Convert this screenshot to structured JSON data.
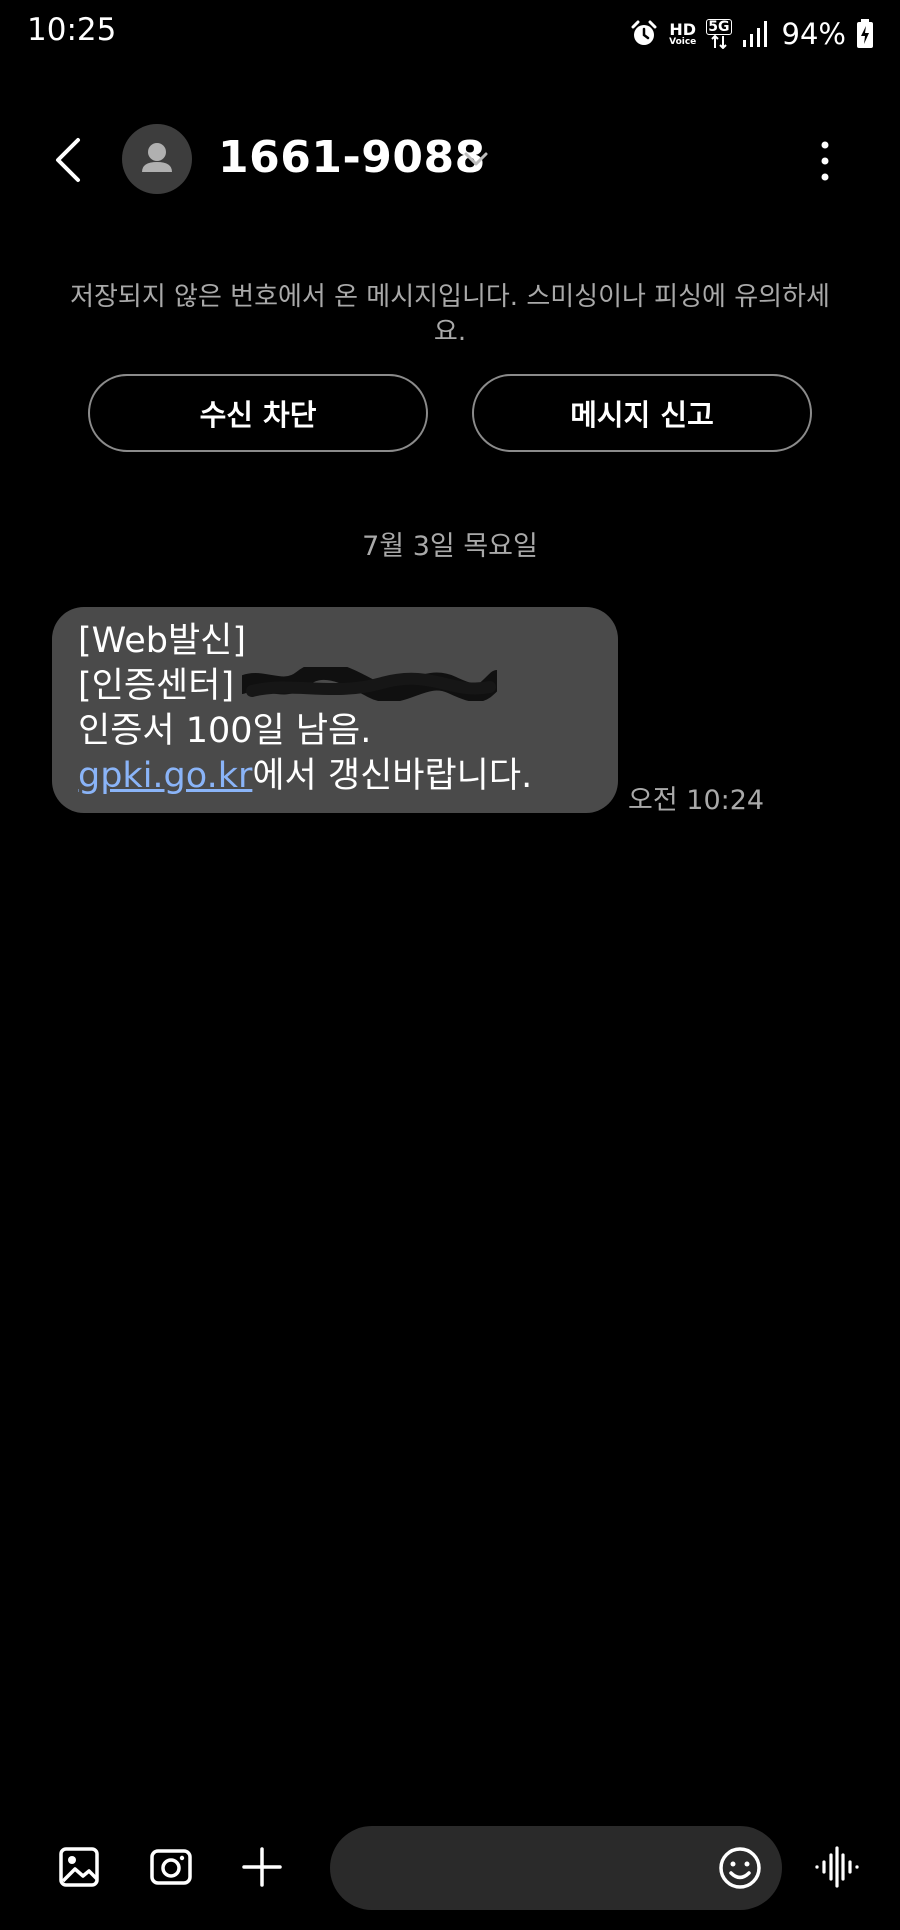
{
  "status_bar": {
    "time": "10:25",
    "hd_top": "HD",
    "hd_bottom": "Voice",
    "network": "5G",
    "battery": "94%",
    "icons": [
      "alarm-icon",
      "hd-voice-icon",
      "5g-icon",
      "signal-icon",
      "battery-charging-icon"
    ]
  },
  "header": {
    "sender": "1661-9088",
    "icons": [
      "back-icon",
      "avatar-person-icon",
      "chevron-down-icon",
      "more-vertical-icon"
    ]
  },
  "warning": {
    "text": "저장되지 않은 번호에서 온 메시지입니다. 스미싱이나 피싱에 유의하세요.",
    "block_label": "수신 차단",
    "report_label": "메시지 신고"
  },
  "conversation": {
    "date": "7월 3일 목요일",
    "message": {
      "line1": "[Web발신]",
      "line2_prefix": "[인증센터]",
      "line3": "인증서 100일 남음.",
      "link": "gpki.go.kr",
      "line4_suffix": "에서 갱신바랍니다.",
      "time": "오전 10:24"
    }
  },
  "composer": {
    "icons": [
      "gallery-icon",
      "camera-icon",
      "plus-icon",
      "emoji-icon",
      "voice-record-icon"
    ]
  },
  "colors": {
    "background": "#000000",
    "bubble": "#4a4a4a",
    "link": "#8ab4f8",
    "muted": "#a9a9a9",
    "composer": "#2a2a2a"
  }
}
